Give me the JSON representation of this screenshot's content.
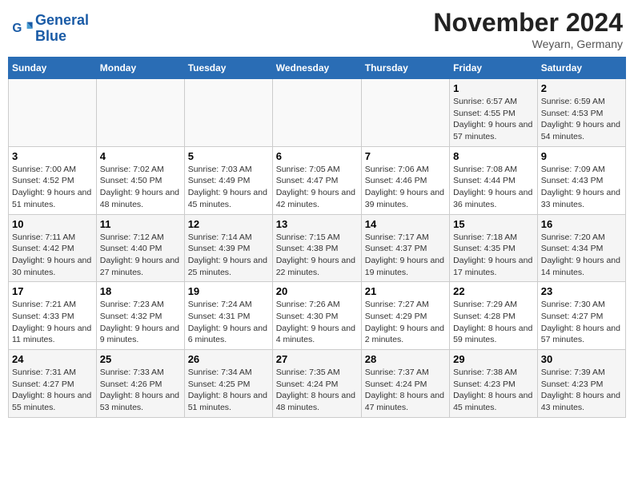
{
  "header": {
    "logo_line1": "General",
    "logo_line2": "Blue",
    "month_title": "November 2024",
    "location": "Weyarn, Germany"
  },
  "days_of_week": [
    "Sunday",
    "Monday",
    "Tuesday",
    "Wednesday",
    "Thursday",
    "Friday",
    "Saturday"
  ],
  "weeks": [
    [
      {
        "day": "",
        "info": ""
      },
      {
        "day": "",
        "info": ""
      },
      {
        "day": "",
        "info": ""
      },
      {
        "day": "",
        "info": ""
      },
      {
        "day": "",
        "info": ""
      },
      {
        "day": "1",
        "info": "Sunrise: 6:57 AM\nSunset: 4:55 PM\nDaylight: 9 hours and 57 minutes."
      },
      {
        "day": "2",
        "info": "Sunrise: 6:59 AM\nSunset: 4:53 PM\nDaylight: 9 hours and 54 minutes."
      }
    ],
    [
      {
        "day": "3",
        "info": "Sunrise: 7:00 AM\nSunset: 4:52 PM\nDaylight: 9 hours and 51 minutes."
      },
      {
        "day": "4",
        "info": "Sunrise: 7:02 AM\nSunset: 4:50 PM\nDaylight: 9 hours and 48 minutes."
      },
      {
        "day": "5",
        "info": "Sunrise: 7:03 AM\nSunset: 4:49 PM\nDaylight: 9 hours and 45 minutes."
      },
      {
        "day": "6",
        "info": "Sunrise: 7:05 AM\nSunset: 4:47 PM\nDaylight: 9 hours and 42 minutes."
      },
      {
        "day": "7",
        "info": "Sunrise: 7:06 AM\nSunset: 4:46 PM\nDaylight: 9 hours and 39 minutes."
      },
      {
        "day": "8",
        "info": "Sunrise: 7:08 AM\nSunset: 4:44 PM\nDaylight: 9 hours and 36 minutes."
      },
      {
        "day": "9",
        "info": "Sunrise: 7:09 AM\nSunset: 4:43 PM\nDaylight: 9 hours and 33 minutes."
      }
    ],
    [
      {
        "day": "10",
        "info": "Sunrise: 7:11 AM\nSunset: 4:42 PM\nDaylight: 9 hours and 30 minutes."
      },
      {
        "day": "11",
        "info": "Sunrise: 7:12 AM\nSunset: 4:40 PM\nDaylight: 9 hours and 27 minutes."
      },
      {
        "day": "12",
        "info": "Sunrise: 7:14 AM\nSunset: 4:39 PM\nDaylight: 9 hours and 25 minutes."
      },
      {
        "day": "13",
        "info": "Sunrise: 7:15 AM\nSunset: 4:38 PM\nDaylight: 9 hours and 22 minutes."
      },
      {
        "day": "14",
        "info": "Sunrise: 7:17 AM\nSunset: 4:37 PM\nDaylight: 9 hours and 19 minutes."
      },
      {
        "day": "15",
        "info": "Sunrise: 7:18 AM\nSunset: 4:35 PM\nDaylight: 9 hours and 17 minutes."
      },
      {
        "day": "16",
        "info": "Sunrise: 7:20 AM\nSunset: 4:34 PM\nDaylight: 9 hours and 14 minutes."
      }
    ],
    [
      {
        "day": "17",
        "info": "Sunrise: 7:21 AM\nSunset: 4:33 PM\nDaylight: 9 hours and 11 minutes."
      },
      {
        "day": "18",
        "info": "Sunrise: 7:23 AM\nSunset: 4:32 PM\nDaylight: 9 hours and 9 minutes."
      },
      {
        "day": "19",
        "info": "Sunrise: 7:24 AM\nSunset: 4:31 PM\nDaylight: 9 hours and 6 minutes."
      },
      {
        "day": "20",
        "info": "Sunrise: 7:26 AM\nSunset: 4:30 PM\nDaylight: 9 hours and 4 minutes."
      },
      {
        "day": "21",
        "info": "Sunrise: 7:27 AM\nSunset: 4:29 PM\nDaylight: 9 hours and 2 minutes."
      },
      {
        "day": "22",
        "info": "Sunrise: 7:29 AM\nSunset: 4:28 PM\nDaylight: 8 hours and 59 minutes."
      },
      {
        "day": "23",
        "info": "Sunrise: 7:30 AM\nSunset: 4:27 PM\nDaylight: 8 hours and 57 minutes."
      }
    ],
    [
      {
        "day": "24",
        "info": "Sunrise: 7:31 AM\nSunset: 4:27 PM\nDaylight: 8 hours and 55 minutes."
      },
      {
        "day": "25",
        "info": "Sunrise: 7:33 AM\nSunset: 4:26 PM\nDaylight: 8 hours and 53 minutes."
      },
      {
        "day": "26",
        "info": "Sunrise: 7:34 AM\nSunset: 4:25 PM\nDaylight: 8 hours and 51 minutes."
      },
      {
        "day": "27",
        "info": "Sunrise: 7:35 AM\nSunset: 4:24 PM\nDaylight: 8 hours and 48 minutes."
      },
      {
        "day": "28",
        "info": "Sunrise: 7:37 AM\nSunset: 4:24 PM\nDaylight: 8 hours and 47 minutes."
      },
      {
        "day": "29",
        "info": "Sunrise: 7:38 AM\nSunset: 4:23 PM\nDaylight: 8 hours and 45 minutes."
      },
      {
        "day": "30",
        "info": "Sunrise: 7:39 AM\nSunset: 4:23 PM\nDaylight: 8 hours and 43 minutes."
      }
    ]
  ]
}
